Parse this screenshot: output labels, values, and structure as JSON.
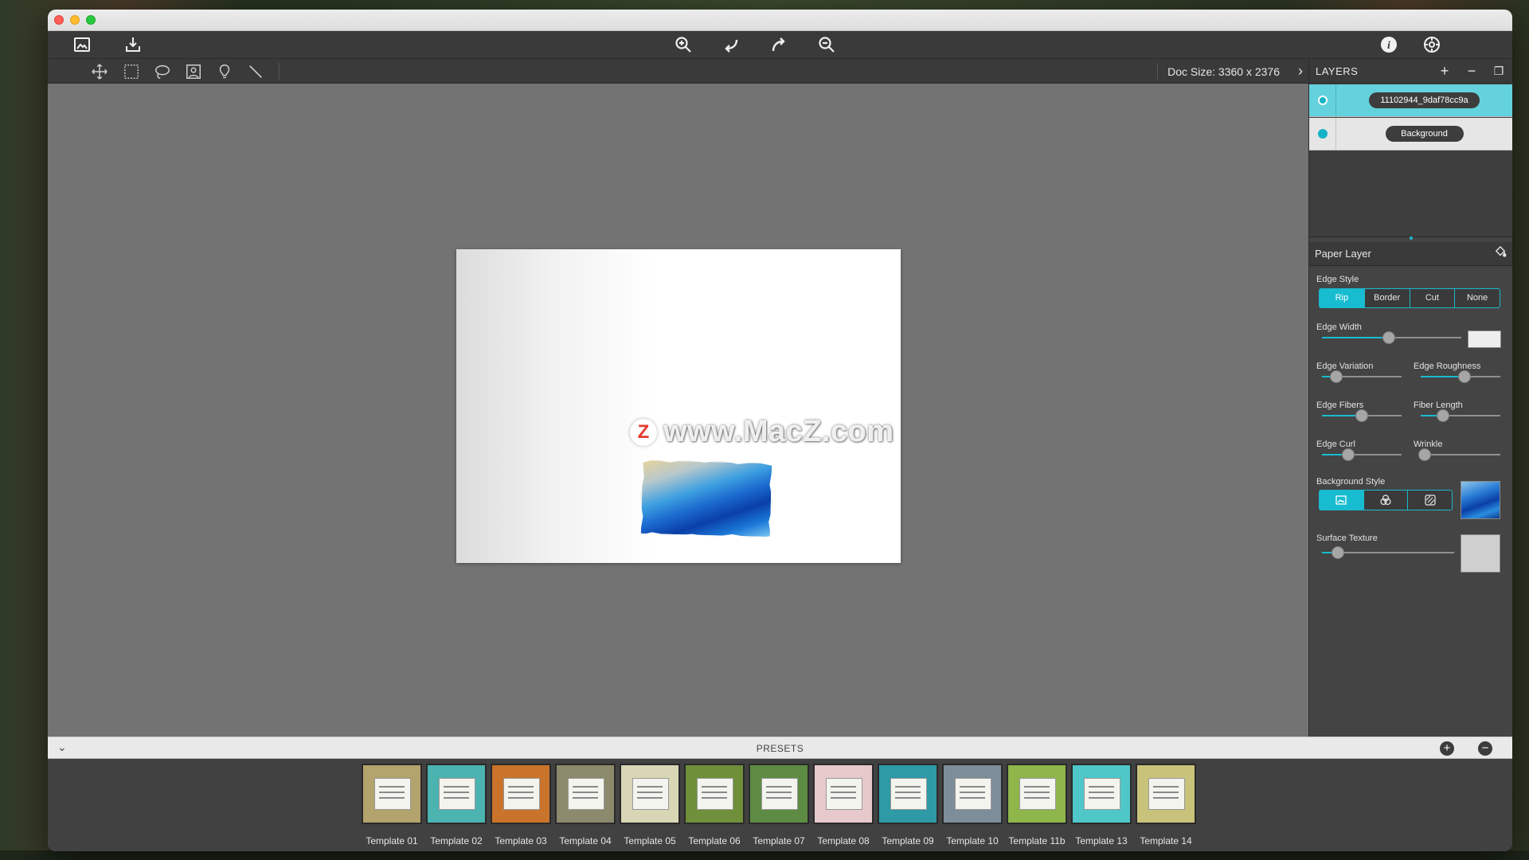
{
  "app": {
    "toolbar": {
      "left_icons": [
        "image-frame-icon",
        "import-icon"
      ],
      "center_icons": [
        "zoom-in-icon",
        "undo-icon",
        "redo-icon",
        "zoom-out-icon"
      ],
      "right_icons": [
        "info-icon",
        "settings-icon"
      ]
    },
    "tools": [
      "move-icon",
      "rect-select-icon",
      "lasso-icon",
      "portrait-select-icon",
      "brush-icon",
      "line-icon"
    ],
    "doc_size": "Doc Size: 3360 x 2376",
    "doc_chevron": "›"
  },
  "canvas": {
    "watermark_badge": "Z",
    "watermark_text": "www.MacZ.com"
  },
  "layers": {
    "title": "LAYERS",
    "add": "+",
    "remove": "−",
    "duplicate": "❐",
    "items": [
      {
        "name": "11102944_9daf78cc9a",
        "selected": true
      },
      {
        "name": "Background",
        "selected": false
      }
    ]
  },
  "paper_layer": {
    "title": "Paper Layer",
    "edge_style_label": "Edge Style",
    "edge_styles": [
      "Rip",
      "Border",
      "Cut",
      "None"
    ],
    "edge_style_selected": "Rip",
    "edge_width_label": "Edge Width",
    "edge_width": 0.48,
    "edge_variation_label": "Edge Variation",
    "edge_variation": 0.18,
    "edge_roughness_label": "Edge Roughness",
    "edge_roughness": 0.55,
    "edge_fibers_label": "Edge Fibers",
    "edge_fibers": 0.5,
    "fiber_length_label": "Fiber Length",
    "fiber_length": 0.28,
    "edge_curl_label": "Edge Curl",
    "edge_curl": 0.33,
    "wrinkle_label": "Wrinkle",
    "wrinkle": 0.05,
    "background_style_label": "Background Style",
    "background_style_icons": [
      "image-icon",
      "color-circles-icon",
      "texture-icon"
    ],
    "surface_texture_label": "Surface Texture",
    "surface_texture": 0.12,
    "colors": {
      "accent": "#18bcd0",
      "edge_width_swatch": "#eeeeee",
      "surface_swatch": "#cfcfcf"
    }
  },
  "presets": {
    "title": "PRESETS",
    "collapse": "⌄",
    "add": "+",
    "remove": "−",
    "items": [
      {
        "label": "Template 01",
        "color": "#b3a36c"
      },
      {
        "label": "Template 02",
        "color": "#4bb3b0"
      },
      {
        "label": "Template 03",
        "color": "#c9742a"
      },
      {
        "label": "Template 04",
        "color": "#8b8a6c"
      },
      {
        "label": "Template 05",
        "color": "#d8d6b4"
      },
      {
        "label": "Template 06",
        "color": "#6f8f3a"
      },
      {
        "label": "Template 07",
        "color": "#5e8b43"
      },
      {
        "label": "Template 08",
        "color": "#e7c9cc"
      },
      {
        "label": "Template 09",
        "color": "#2d9aa6"
      },
      {
        "label": "Template 10",
        "color": "#7d8d9a"
      },
      {
        "label": "Template 11b",
        "color": "#8fb64a"
      },
      {
        "label": "Template 13",
        "color": "#4fc7c9"
      },
      {
        "label": "Template 14",
        "color": "#c9c27a"
      }
    ]
  }
}
